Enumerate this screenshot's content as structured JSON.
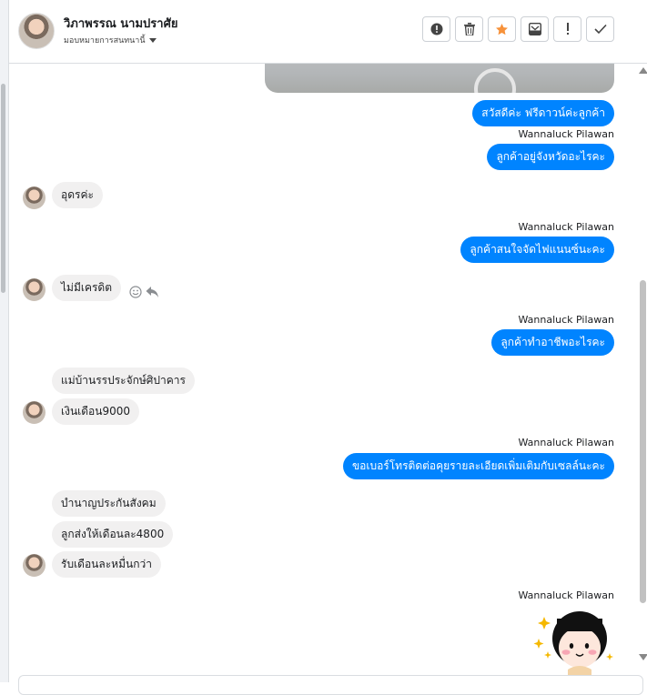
{
  "header": {
    "contact_name": "วิภาพรรณ นามปราศัย",
    "subtitle": "มอบหมายการสนทนานี้",
    "toolbar": [
      "alert-icon",
      "trash-icon",
      "star-icon",
      "archive-icon",
      "exclamation-icon",
      "check-icon"
    ],
    "star_color": "#f7923a"
  },
  "messages": {
    "m1": "สวัสดีค่ะ  ฟรีดาวน์ค่ะลูกค้า",
    "s1": "Wannaluck Pilawan",
    "m2": "ลูกค้าอยู่จังหวัดอะไรคะ",
    "r1": "อุดรค่ะ",
    "s2": "Wannaluck Pilawan",
    "m3": "ลูกค้าสนใจจัดไฟแนนซ์นะคะ",
    "r2": "ไม่มีเครดิต",
    "s3": "Wannaluck Pilawan",
    "m4": "ลูกค้าทำอาชีพอะไรคะ",
    "r3": "แม่บ้านรรประจักษ์ศิปาคาร",
    "r4": "เงินเดือน9000",
    "s4": "Wannaluck Pilawan",
    "m5": "ขอเบอร์โทรติดต่อคุยรายละเอียดเพิ่มเติมกับเซลล์นะคะ",
    "r5": "บำนาญประกันสังคม",
    "r6": "ลูกส่งให้เดือนละ4800",
    "r7": "รับเดือนละหมื่นกว่า",
    "s5": "Wannaluck Pilawan"
  },
  "colors": {
    "outgoing": "#0084ff",
    "incoming": "#f1f0f0"
  }
}
